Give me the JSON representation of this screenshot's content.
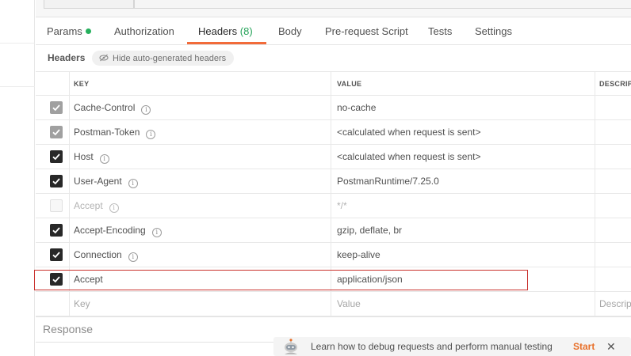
{
  "tabs": [
    {
      "label": "Params",
      "has_dot": true
    },
    {
      "label": "Authorization"
    },
    {
      "label": "Headers",
      "count": "(8)",
      "active": true
    },
    {
      "label": "Body"
    },
    {
      "label": "Pre-request Script"
    },
    {
      "label": "Tests"
    },
    {
      "label": "Settings"
    }
  ],
  "headers_section": {
    "title": "Headers",
    "hide_button_label": "Hide auto-generated headers"
  },
  "table": {
    "columns": [
      "KEY",
      "VALUE",
      "DESCRIP"
    ],
    "rows": [
      {
        "key": "Cache-Control",
        "value": "no-cache",
        "state": "auto",
        "info": true
      },
      {
        "key": "Postman-Token",
        "value": "<calculated when request is sent>",
        "state": "auto",
        "info": true
      },
      {
        "key": "Host",
        "value": "<calculated when request is sent>",
        "state": "on",
        "info": true
      },
      {
        "key": "User-Agent",
        "value": "PostmanRuntime/7.25.0",
        "state": "on",
        "info": true
      },
      {
        "key": "Accept",
        "value": "*/*",
        "state": "off",
        "info": true
      },
      {
        "key": "Accept-Encoding",
        "value": "gzip, deflate, br",
        "state": "on",
        "info": true
      },
      {
        "key": "Connection",
        "value": "keep-alive",
        "state": "on",
        "info": true
      },
      {
        "key": "Accept",
        "value": "application/json",
        "state": "on",
        "info": false
      }
    ],
    "new_row": {
      "key_placeholder": "Key",
      "value_placeholder": "Value",
      "description_placeholder": "Descript"
    }
  },
  "response": {
    "label": "Response"
  },
  "toast": {
    "message": "Learn how to debug requests and perform manual testing",
    "action_label": "Start",
    "close_glyph": "✕"
  },
  "colors": {
    "accent": "#f26b3a",
    "params_dot": "#26b05d",
    "headers_count": "#26a35a",
    "highlight_border": "#c9302c",
    "toast_action": "#e8702a"
  },
  "icons": {
    "info": "info-icon",
    "hide": "eye-slash-icon",
    "check": "check-icon",
    "close": "close-icon",
    "toast": "postman-bot-icon"
  }
}
